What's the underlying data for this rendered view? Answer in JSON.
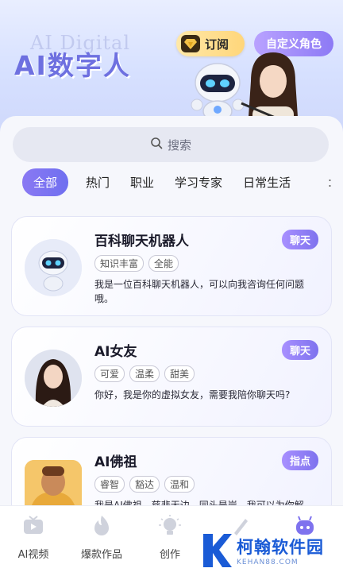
{
  "status_bar": {
    "wifi_icon": "wifi-icon",
    "battery_icon": "battery-icon"
  },
  "banner": {
    "bg_text": "AI Digital",
    "title": "AI数字人",
    "subscribe_label": "订阅",
    "custom_role_label": "自定义角色"
  },
  "search": {
    "placeholder": "搜索"
  },
  "tabs": [
    "全部",
    "热门",
    "职业",
    "学习专家",
    "日常生活"
  ],
  "tab_more": "：",
  "cards": [
    {
      "title": "百科聊天机器人",
      "action": "聊天",
      "tags": [
        "知识丰富",
        "全能"
      ],
      "desc": "我是一位百科聊天机器人，可以向我咨询任何问题哦。"
    },
    {
      "title": "AI女友",
      "action": "聊天",
      "tags": [
        "可爱",
        "温柔",
        "甜美"
      ],
      "desc": "你好，我是你的虚拟女友，需要我陪你聊天吗?"
    },
    {
      "title": "AI佛祖",
      "action": "指点",
      "tags": [
        "睿智",
        "豁达",
        "温和"
      ],
      "desc": "我是AI佛祖，慈悲无边，同头是岸，我可以为你解"
    }
  ],
  "nav": [
    "AI视频",
    "爆款作品",
    "创作",
    "",
    ""
  ],
  "watermark": {
    "name": "柯翰软件园",
    "url": "KEHAN88.COM"
  },
  "colors": {
    "accent": "#7e72ee",
    "title": "#6e70e0",
    "gold": "#ffd67a"
  }
}
